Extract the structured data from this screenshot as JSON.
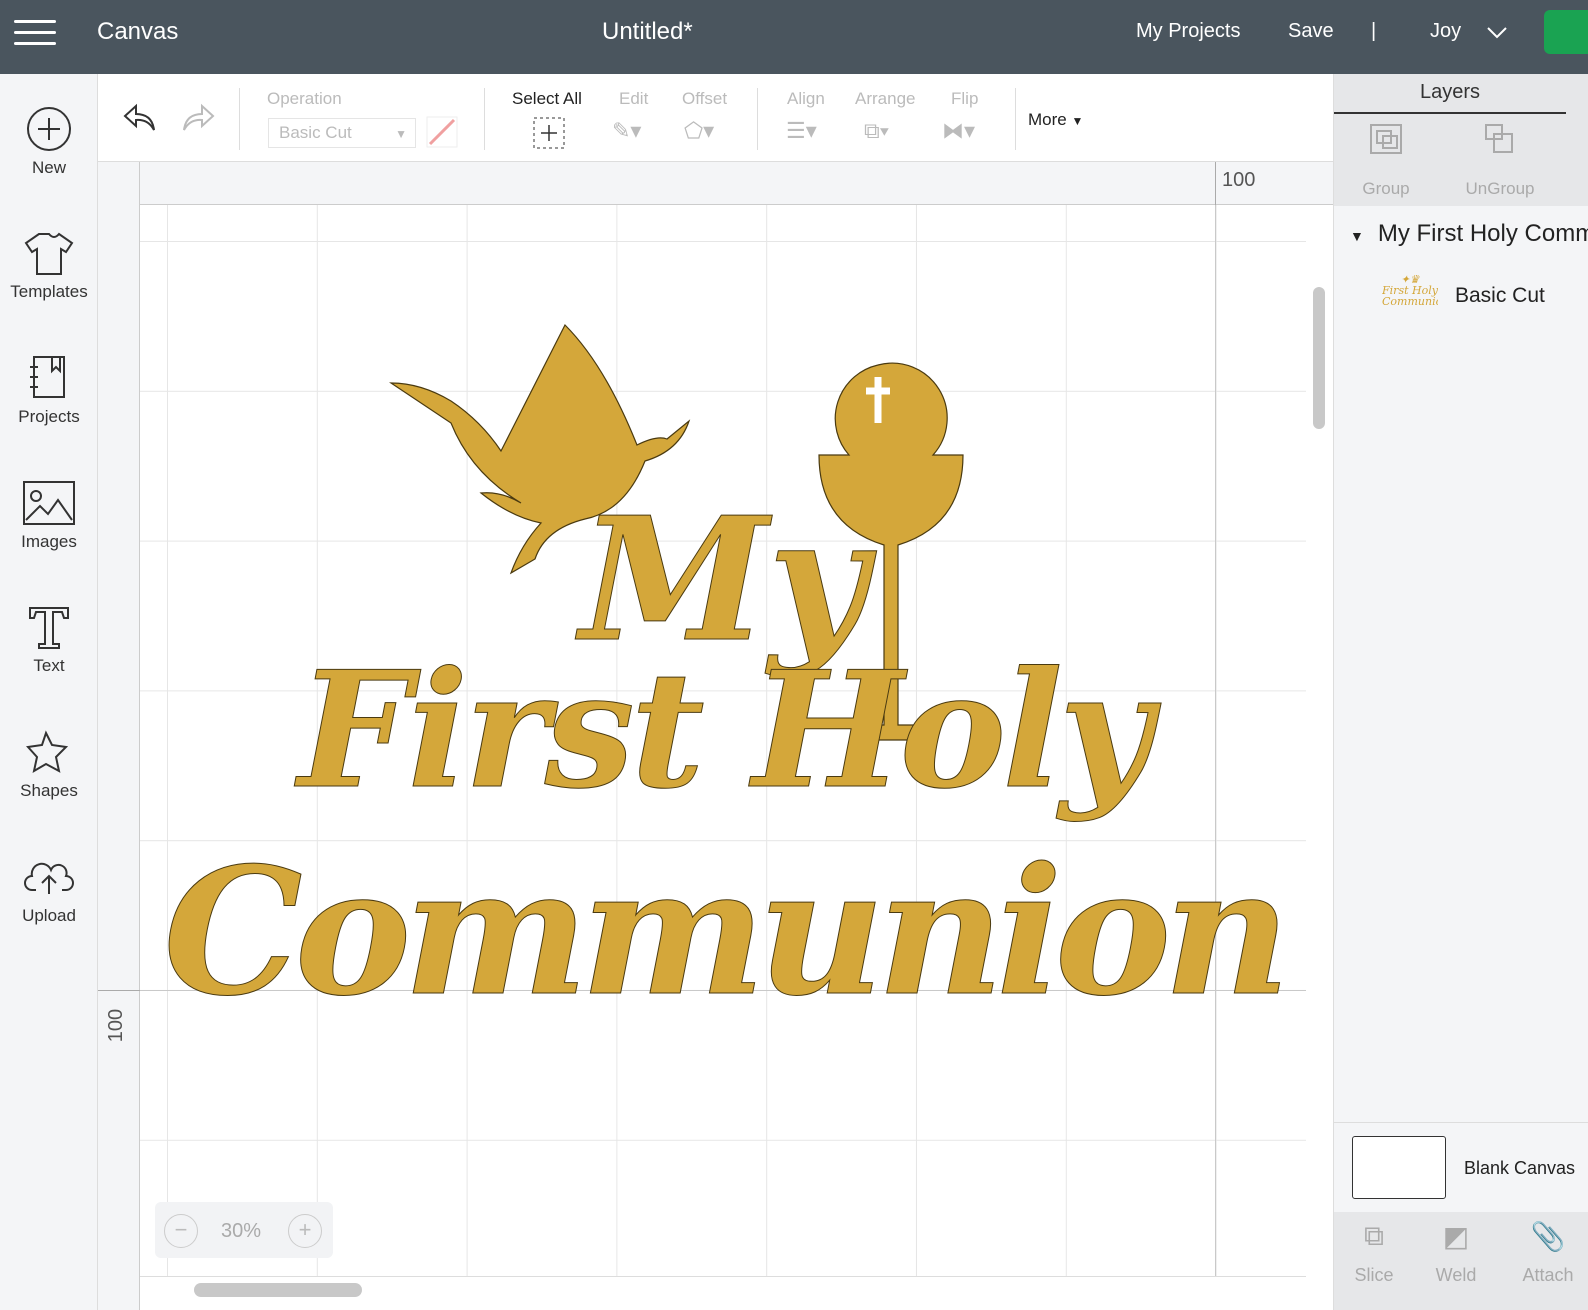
{
  "topbar": {
    "app": "Canvas",
    "title": "Untitled*",
    "my_projects": "My Projects",
    "save": "Save",
    "divider": "|",
    "user": "Joy"
  },
  "sidebar": [
    {
      "label": "New",
      "icon": "plus-circle-icon"
    },
    {
      "label": "Templates",
      "icon": "tshirt-icon"
    },
    {
      "label": "Projects",
      "icon": "notebook-icon"
    },
    {
      "label": "Images",
      "icon": "image-icon"
    },
    {
      "label": "Text",
      "icon": "text-icon"
    },
    {
      "label": "Shapes",
      "icon": "shapes-icon"
    },
    {
      "label": "Upload",
      "icon": "cloud-upload-icon"
    }
  ],
  "toolbar": {
    "operation_label": "Operation",
    "operation_value": "Basic Cut",
    "select_all": "Select All",
    "edit": "Edit",
    "offset": "Offset",
    "align": "Align",
    "arrange": "Arrange",
    "flip": "Flip",
    "more": "More"
  },
  "ruler": {
    "top_mark": "100",
    "left_mark": "100"
  },
  "zoom": {
    "level": "30%"
  },
  "design": {
    "line1": "My",
    "line2": "First Holy",
    "line3": "Communion",
    "color": "#d4a73a"
  },
  "layers": {
    "tab": "Layers",
    "group": "Group",
    "ungroup": "UnGroup",
    "group_name": "My First Holy Communion",
    "item": "Basic Cut",
    "canvas": "Blank Canvas",
    "slice": "Slice",
    "weld": "Weld",
    "attach": "Attach"
  }
}
